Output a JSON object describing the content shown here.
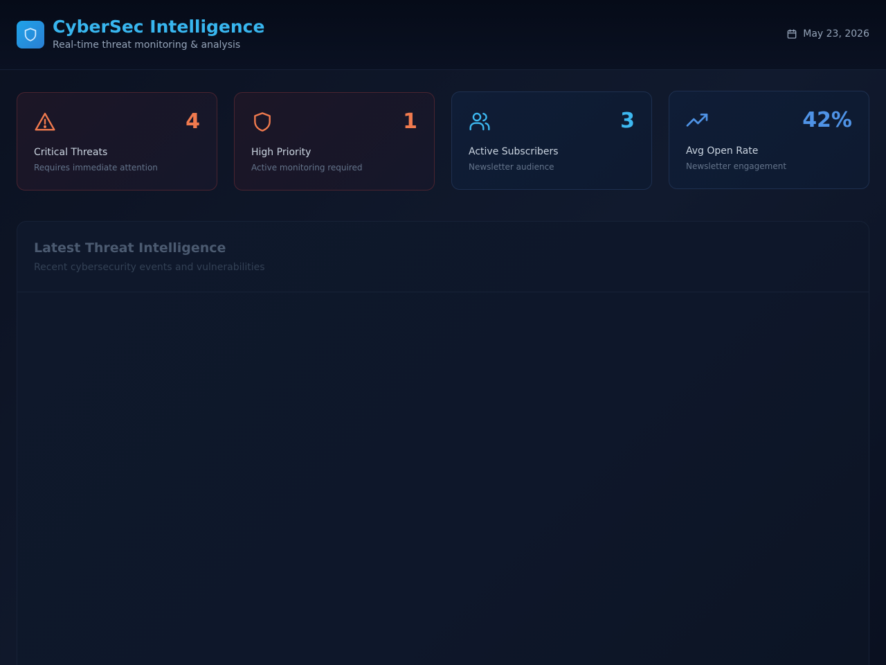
{
  "header": {
    "title": "CyberSec Intelligence",
    "subtitle": "Real-time threat monitoring & analysis",
    "date": "May 23, 2026",
    "logo_icon": "shield-icon",
    "date_icon": "calendar-icon"
  },
  "stats": [
    {
      "label": "Critical Threats",
      "sub": "Requires immediate attention",
      "value": "4",
      "icon": "alert-triangle-icon",
      "color": "#f07a4e"
    },
    {
      "label": "High Priority",
      "sub": "Active monitoring required",
      "value": "1",
      "icon": "shield-icon",
      "color": "#f07a4e"
    },
    {
      "label": "Active Subscribers",
      "sub": "Newsletter audience",
      "value": "3",
      "icon": "users-icon",
      "color": "#3db8f0"
    },
    {
      "label": "Avg Open Rate",
      "sub": "Newsletter engagement",
      "value": "42%",
      "icon": "trending-up-icon",
      "color": "#4f93e6"
    }
  ],
  "threats_panel": {
    "title": "Latest Threat Intelligence",
    "subtitle": "Recent cybersecurity events and vulnerabilities"
  },
  "colors": {
    "accent": "#38b6ef",
    "danger": "#f07a4e",
    "info": "#3db8f0",
    "background": "#0e172a"
  }
}
